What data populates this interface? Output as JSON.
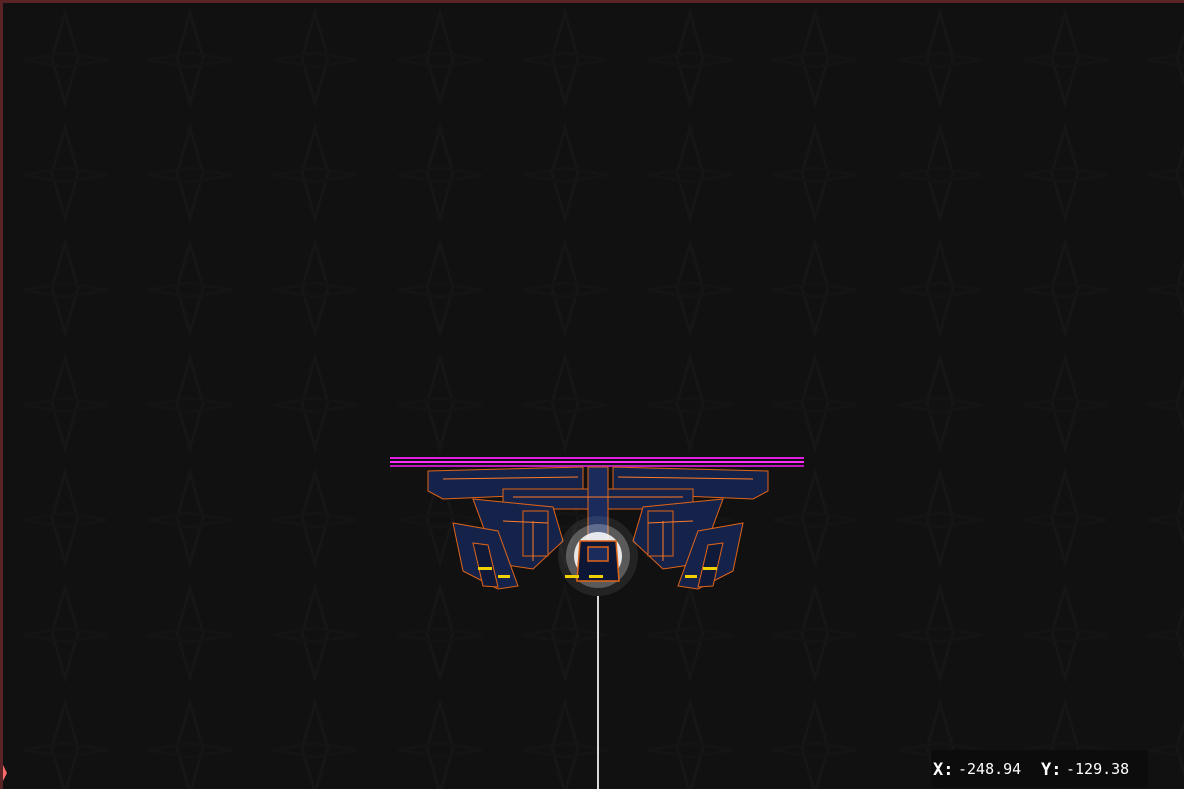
{
  "scene": {
    "background_color": "#111111",
    "border_color": "#5a2326",
    "shield_color": "#e020e0",
    "hull_color": "#15234a",
    "trim_color": "#e06418",
    "light_color": "#f0d000",
    "icon": "player-ship-icon"
  },
  "coords": {
    "x_label": "X:",
    "x_value": "-248.94",
    "y_label": "Y:",
    "y_value": "-129.38"
  }
}
